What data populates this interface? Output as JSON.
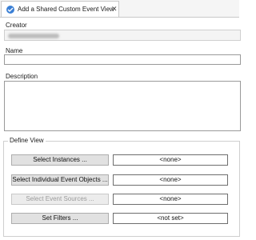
{
  "tab": {
    "title": "Add a Shared Custom Event View",
    "close_glyph": "✕"
  },
  "creator": {
    "label": "Creator",
    "value_blurred": true
  },
  "name": {
    "label": "Name",
    "value": ""
  },
  "description": {
    "label": "Description",
    "value": ""
  },
  "define_view": {
    "title": "Define View",
    "rows": [
      {
        "button": "Select Instances ...",
        "value": "<none>",
        "enabled": true
      },
      {
        "button": "Select Individual Event Objects ...",
        "value": "<none>",
        "enabled": true
      },
      {
        "button": "Select Event Sources ...",
        "value": "<none>",
        "enabled": false
      },
      {
        "button": "Set Filters ...",
        "value": "<not set>",
        "enabled": true
      }
    ]
  }
}
